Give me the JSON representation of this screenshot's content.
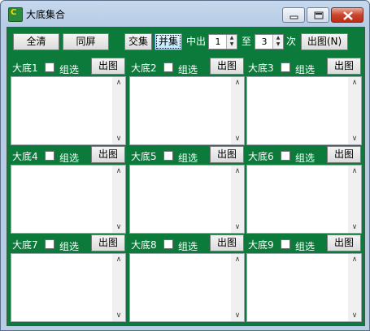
{
  "window": {
    "title": "大底集合",
    "app_icon": "app-logo-icon"
  },
  "toolbar": {
    "clear_all": "全清",
    "same_screen": "同屏",
    "intersection": "交集",
    "union": "并集",
    "hit_label": "中出",
    "min_value": "1",
    "to_label": "至",
    "max_value": "3",
    "times_label": "次",
    "output_n": "出图(N)"
  },
  "panels": [
    {
      "name": "大底1",
      "check_label": "组选",
      "output_label": "出图"
    },
    {
      "name": "大底2",
      "check_label": "组选",
      "output_label": "出图"
    },
    {
      "name": "大底3",
      "check_label": "组选",
      "output_label": "出图"
    },
    {
      "name": "大底4",
      "check_label": "组选",
      "output_label": "出图"
    },
    {
      "name": "大底5",
      "check_label": "组选",
      "output_label": "出图"
    },
    {
      "name": "大底6",
      "check_label": "组选",
      "output_label": "出图"
    },
    {
      "name": "大底7",
      "check_label": "组选",
      "output_label": "出图"
    },
    {
      "name": "大底8",
      "check_label": "组选",
      "output_label": "出图"
    },
    {
      "name": "大底9",
      "check_label": "组选",
      "output_label": "出图"
    }
  ],
  "colors": {
    "client_bg": "#0b7a3b",
    "title_bar": "#b7cde6"
  }
}
